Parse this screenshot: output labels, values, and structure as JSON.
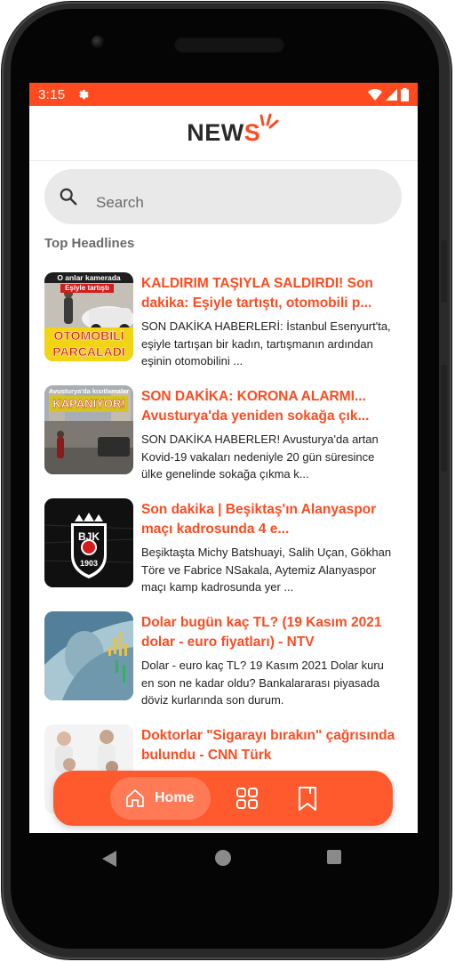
{
  "status_bar": {
    "time": "3:15",
    "color": "#ff4b1f",
    "icons": [
      "gear-icon",
      "wifi-icon",
      "signal-icon",
      "battery-icon"
    ]
  },
  "header": {
    "logo_main": "NEW",
    "logo_accent": "S"
  },
  "search": {
    "placeholder": "Search"
  },
  "section": {
    "title": "Top Headlines"
  },
  "news": [
    {
      "title": "KALDIRIM TAŞIYLA SALDIRDI! Son dakika: Eşiyle tartıştı, otomobili p...",
      "description": "SON DAKİKA HABERLERİ: İstanbul Esenyurt'ta, eşiyle tartışan bir kadın, tartışmanın ardından eşinin otomobilini ...",
      "thumb_top": "O anlar kamerada",
      "thumb_sub": "Eşiyle tartıştı",
      "thumb_bottom": "OTOMOBİLİ PARÇALADI"
    },
    {
      "title": "SON DAKİKA: KORONA ALARMI... Avusturya'da yeniden sokağa çık...",
      "description": "SON DAKİKA HABERLER! Avusturya'da artan Kovid-19 vakaları nedeniyle 20 gün süresince ülke genelinde sokağa çıkma k...",
      "thumb_top": "Avusturya'da kısıtlamalar",
      "thumb_bottom": "KAPANIYOR!"
    },
    {
      "title": "Son dakika | Beşiktaş'ın Alanyaspor maçı kadrosunda 4 e...",
      "description": "Beşiktaşta Michy Batshuayi, Salih Uçan, Gökhan Töre ve Fabrice NSakala, Aytemiz Alanyaspor maçı kamp kadrosunda yer ...",
      "thumb_logo_text": "BJK",
      "thumb_year": "1903"
    },
    {
      "title": "Dolar bugün kaç TL? (19 Kasım 2021 dolar - euro fiyatları) - NTV",
      "description": "Dolar - euro kaç TL? 19 Kasım 2021 Dolar kuru en son ne kadar oldu? Bankalararası piyasada döviz kurlarında son durum."
    },
    {
      "title": "Doktorlar \"Sigarayı bırakın\" çağrısında bulundu - CNN Türk",
      "description": ""
    }
  ],
  "bottom_nav": {
    "home_label": "Home",
    "icons": [
      "home-icon",
      "grid-icon",
      "bookmark-icon"
    ]
  },
  "colors": {
    "accent": "#ff4b1f",
    "nav_bg": "#ff5a2e",
    "nav_active": "#ff7a55"
  }
}
